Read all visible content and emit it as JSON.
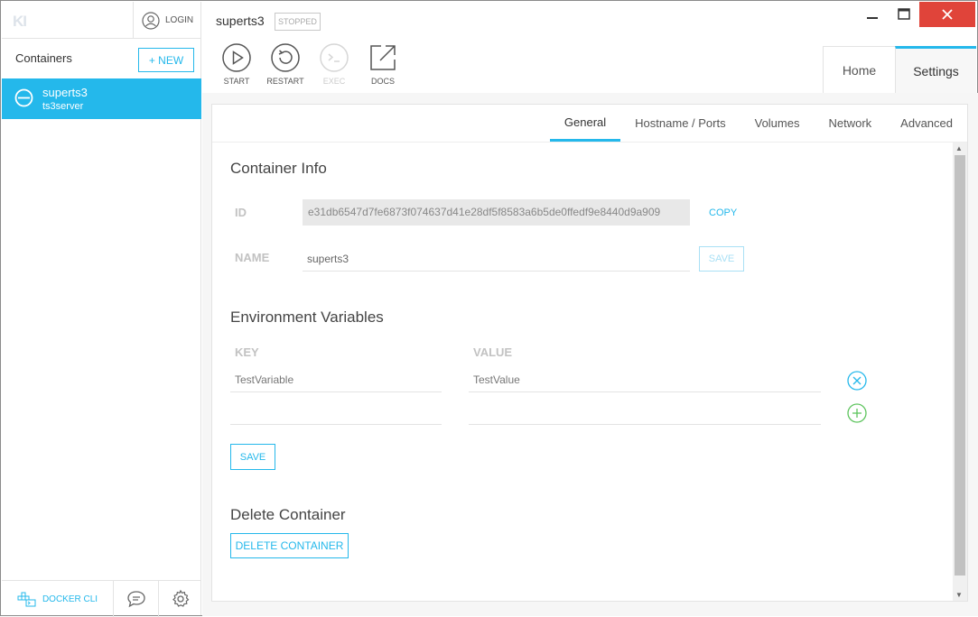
{
  "app": {
    "logo": "KI"
  },
  "sidebar": {
    "login_label": "LOGIN",
    "title": "Containers",
    "new_label": "+ NEW",
    "containers": [
      {
        "name": "superts3",
        "image": "ts3server"
      }
    ],
    "footer": {
      "docker_cli_label": "DOCKER CLI"
    }
  },
  "header": {
    "container_name": "superts3",
    "status": "STOPPED",
    "actions": [
      {
        "label": "START",
        "icon": "play-icon",
        "enabled": true
      },
      {
        "label": "RESTART",
        "icon": "restart-icon",
        "enabled": true
      },
      {
        "label": "EXEC",
        "icon": "terminal-icon",
        "enabled": false
      },
      {
        "label": "DOCS",
        "icon": "external-link-icon",
        "enabled": true
      }
    ],
    "view_tabs": [
      {
        "label": "Home",
        "active": false
      },
      {
        "label": "Settings",
        "active": true
      }
    ]
  },
  "settings": {
    "tabs": [
      {
        "label": "General",
        "active": true
      },
      {
        "label": "Hostname / Ports",
        "active": false
      },
      {
        "label": "Volumes",
        "active": false
      },
      {
        "label": "Network",
        "active": false
      },
      {
        "label": "Advanced",
        "active": false
      }
    ],
    "container_info": {
      "title": "Container Info",
      "id_label": "ID",
      "id_value": "e31db6547d7fe6873f074637d41e28df5f8583a6b5de0ffedf9e8440d9a909",
      "copy_label": "COPY",
      "name_label": "NAME",
      "name_value": "superts3",
      "save_label": "SAVE"
    },
    "env": {
      "title": "Environment Variables",
      "key_header": "KEY",
      "value_header": "VALUE",
      "rows": [
        {
          "key": "TestVariable",
          "value": "TestValue"
        },
        {
          "key": "",
          "value": ""
        }
      ],
      "save_label": "SAVE"
    },
    "delete": {
      "title": "Delete Container",
      "button_label": "DELETE CONTAINER"
    }
  },
  "colors": {
    "accent": "#24b8eb",
    "close": "#e0443a",
    "add": "#5cc45c"
  }
}
